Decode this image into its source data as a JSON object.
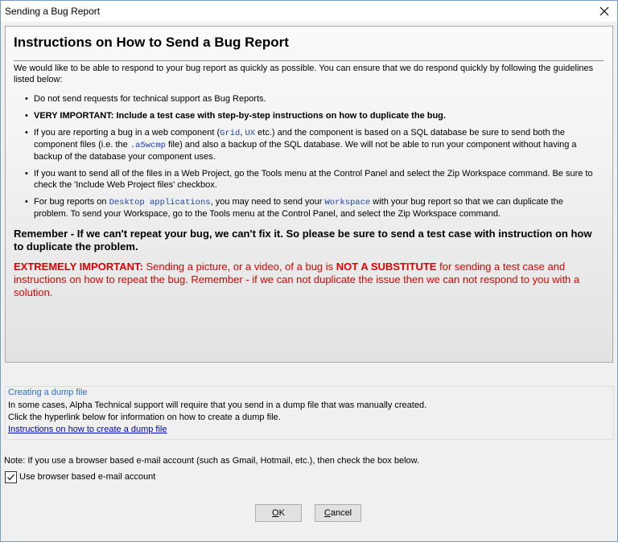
{
  "window": {
    "title": "Sending a Bug Report",
    "close_glyph": "close-icon"
  },
  "instructions": {
    "heading": "Instructions on How to Send a Bug Report",
    "intro": "We would like to be able to respond to your bug report as quickly as possible. You can ensure that we do respond quickly by following the guidelines listed below:",
    "bullet_glyph": "•",
    "item1": "Do not send requests for technical support as Bug Reports.",
    "item2": "VERY IMPORTANT: Include a test case with step-by-step instructions on how to duplicate the bug.",
    "item3_a": "If you are reporting a bug in a web component (",
    "item3_grid": "Grid",
    "item3_comma": ", ",
    "item3_ux": "UX",
    "item3_b": " etc.) and the component is based on a SQL database be sure to send both the component files (i.e. the ",
    "item3_ext": ".a5wcmp",
    "item3_c": " file) and also a backup of the SQL database. We will not be able to run your component without having a backup of the database your component uses.",
    "item4": "If you want to send all of the files in a Web Project, go the Tools menu at the Control Panel and select the Zip Workspace command. Be sure to check the 'Include Web Project files' checkbox.",
    "item5_a": "For bug reports on ",
    "item5_desktop": "Desktop applications",
    "item5_b": ", you may need to send your ",
    "item5_workspace": "Workspace",
    "item5_c": " with your bug report so that we can duplicate the problem. To send your Workspace, go to the Tools menu at the Control Panel, and select the Zip Workspace command.",
    "remember": "Remember - If we can't repeat your bug, we can't fix it. So please be sure to send a test case with instruction on how to duplicate the problem.",
    "important_label": "EXTREMELY IMPORTANT:",
    "important_a": " Sending a picture, or a video, of a bug is ",
    "important_sub": "NOT A SUBSTITUTE",
    "important_b": " for sending a test case and instructions on how to repeat the bug. Remember - if we can not duplicate the issue then we can not respond to you with a solution."
  },
  "dump": {
    "title": "Creating a dump file",
    "line1": "In some cases, Alpha Technical support will require that you send in a dump file that was manually created.",
    "line2": "Click the hyperlink below for information on how to create a dump file.",
    "link": "Instructions on how to create a dump file"
  },
  "note": "Note: If you use a browser based e-mail account (such as Gmail, Hotmail, etc.), then check the box below.",
  "checkbox": {
    "label": "Use browser based e-mail account",
    "checked": true
  },
  "buttons": {
    "ok_key": "O",
    "ok_rest": "K",
    "cancel_key": "C",
    "cancel_rest": "ancel"
  },
  "colors": {
    "red_text": "#e00000",
    "link_blue": "#0000cc",
    "mono_blue": "#1a3fb5"
  }
}
